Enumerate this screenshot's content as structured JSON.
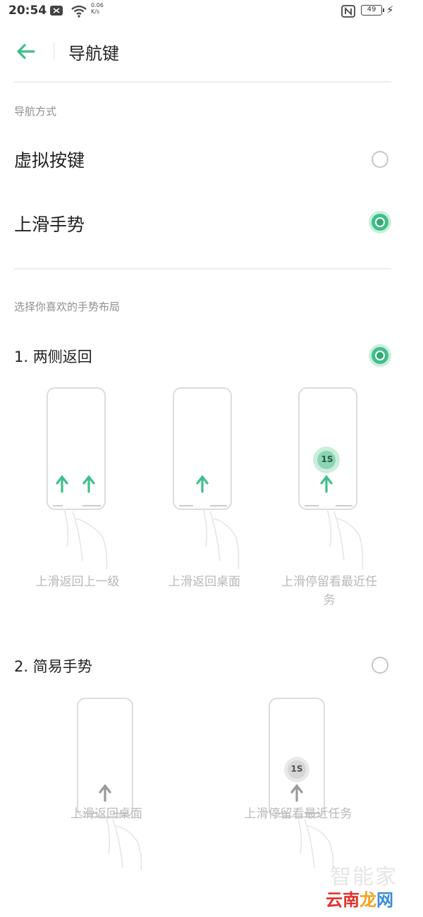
{
  "status_bar": {
    "time": "20:54",
    "net_speed_value": "0.06",
    "net_speed_unit": "K/s",
    "battery": "49",
    "icons": [
      "notification-icon",
      "wifi-icon",
      "nfc-icon",
      "battery-icon",
      "charging-icon"
    ]
  },
  "header": {
    "title": "导航键",
    "back_icon": "arrow-left-icon"
  },
  "nav_mode": {
    "section_label": "导航方式",
    "options": [
      {
        "label": "虚拟按键",
        "selected": false
      },
      {
        "label": "上滑手势",
        "selected": true
      }
    ]
  },
  "gesture_layout": {
    "section_label": "选择你喜欢的手势布局",
    "layouts": [
      {
        "title": "1. 两侧返回",
        "selected": true,
        "illustrations": [
          {
            "caption": "上滑返回上一级"
          },
          {
            "caption": "上滑返回桌面"
          },
          {
            "caption_line1": "上滑停留看最近任",
            "caption_line2": "务",
            "badge": "1S"
          }
        ]
      },
      {
        "title": "2. 简易手势",
        "selected": false,
        "illustrations": [
          {
            "caption": "上滑返回桌面"
          },
          {
            "caption": "上滑停留看最近任务",
            "badge": "1S"
          }
        ]
      }
    ]
  },
  "watermark": {
    "faint": "智能家",
    "brand_a": "云南",
    "brand_b": "龙",
    "brand_c": "网"
  },
  "colors": {
    "accent": "#3fbf8a",
    "accent_dark": "#2fa872",
    "accent_halo": "#c9efdc",
    "muted_text": "#8f8f8f",
    "caption_text": "#b8b8b8",
    "divider": "#eeeeee"
  }
}
